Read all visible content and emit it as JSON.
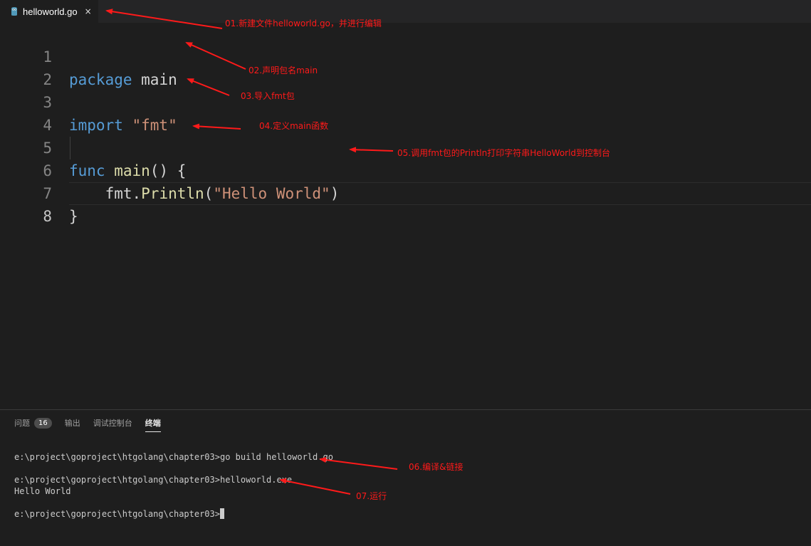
{
  "tab": {
    "filename": "helloworld.go",
    "close_glyph": "×",
    "icon": "go-file-icon"
  },
  "editor": {
    "line_numbers": [
      "1",
      "2",
      "3",
      "4",
      "5",
      "6",
      "7",
      "8"
    ],
    "lines": {
      "l1": {
        "kw": "package",
        "name": " main"
      },
      "l3": {
        "kw": "import",
        "str": " \"fmt\""
      },
      "l5": {
        "kw": "func",
        "fn": " main",
        "rest": "() {"
      },
      "l6": {
        "indent": "    ",
        "pkg": "fmt.",
        "fn": "Println",
        "open": "(",
        "str": "\"Hello World\"",
        "close": ")"
      },
      "l7": {
        "text": "}"
      }
    },
    "colors": {
      "keyword": "#569cd6",
      "function": "#dcdcaa",
      "string": "#ce9178",
      "text": "#d4d4d4"
    }
  },
  "annotations": {
    "a1": "01.新建文件helloworld.go，并进行编辑",
    "a2": "02.声明包名main",
    "a3": "03.导入fmt包",
    "a4": "04.定义main函数",
    "a5": "05.调用fmt包的Println打印字符串HelloWorld到控制台",
    "a6": "06.编译&链接",
    "a7": "07.运行",
    "color": "#ff1a1a"
  },
  "panel": {
    "tabs": {
      "problems": "问题",
      "problems_count": "16",
      "output": "输出",
      "debug_console": "调试控制台",
      "terminal": "终端"
    },
    "terminal_lines": {
      "t1": "e:\\project\\goproject\\htgolang\\chapter03>go build helloworld.go",
      "t2": "e:\\project\\goproject\\htgolang\\chapter03>helloworld.exe",
      "t3": "Hello World",
      "t4": "e:\\project\\goproject\\htgolang\\chapter03>"
    }
  }
}
